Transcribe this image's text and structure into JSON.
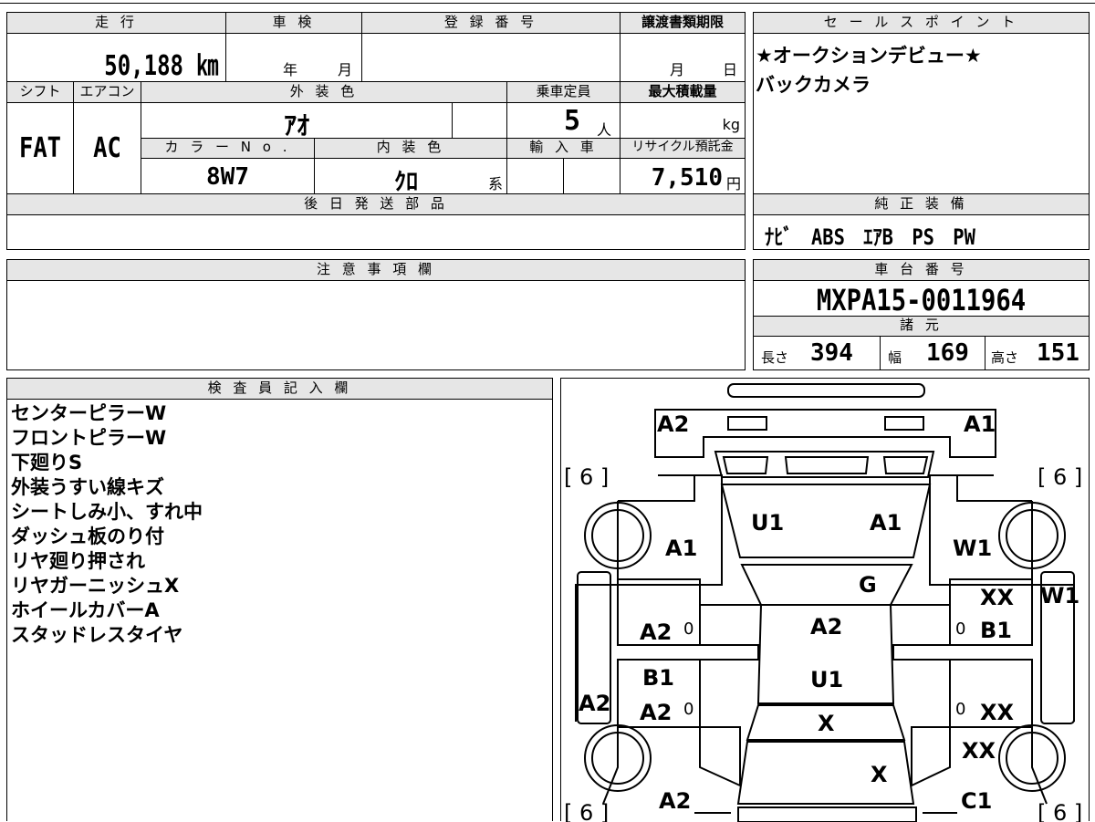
{
  "labels": {
    "mileage": "走 行",
    "inspection": "車 検",
    "registration_no": "登 録 番 号",
    "transfer_deadline": "譲渡書類期限",
    "sales_point": "セ ー ル ス ポ イ ン ト",
    "shift": "シフト",
    "aircon": "エアコン",
    "exterior_color": "外 装 色",
    "capacity": "乗車定員",
    "max_load": "最大積載量",
    "color_no": "カ ラ ー N o .",
    "interior_color": "内 装 色",
    "import": "輸 入 車",
    "recycle_fee": "リサイクル預託金",
    "parts_later": "後 日 発 送 部 品",
    "factory_equipment": "純 正 装 備",
    "caution": "注 意 事 項 欄",
    "chassis_no": "車 台 番 号",
    "specs": "諸 元",
    "inspector_notes": "検 査 員 記 入 欄",
    "year_unit": "年",
    "month_unit": "月",
    "day_unit": "日",
    "person_unit": "人",
    "kg_unit": "kg",
    "yen_unit": "円",
    "kei_unit": "系",
    "length_label": "長さ",
    "width_label": "幅",
    "height_label": "高さ"
  },
  "values": {
    "mileage": "50,188 ㎞",
    "shift": "FAT",
    "aircon": "AC",
    "exterior_color": "ｱｵ",
    "capacity": "5",
    "color_no": "8W7",
    "interior_color": "ｸﾛ",
    "recycle_fee": "7,510",
    "factory_equipment": "ﾅﾋﾞ　ABS　ｴｱB　PS　PW",
    "chassis_no": "MXPA15-0011964",
    "length": "394",
    "width": "169",
    "height": "151"
  },
  "sales_points": [
    "★オークションデビュー★",
    "バックカメラ"
  ],
  "inspector_notes": [
    "センターピラーW",
    "フロントピラーW",
    "下廻りS",
    "外装うすい線キズ",
    "シートしみ小、すれ中",
    "ダッシュ板のり付",
    "リヤ廻り押され",
    "リヤガーニッシュX",
    "ホイールカバーA",
    "スタッドレスタイヤ"
  ],
  "diagram": {
    "tire_left_top": "[ 6 ]",
    "tire_right_top": "[ 6 ]",
    "tire_left_bottom": "[ 6 ]",
    "tire_right_bottom": "[ 6 ]",
    "marks": {
      "front_bumper_left": "A2",
      "front_bumper_right": "A1",
      "hood_left": "U1",
      "hood_right": "A1",
      "fender_left": "A1",
      "fender_right": "W1",
      "windshield": "G",
      "pillar_right": "W1",
      "door_fr_top": "XX",
      "door_fl": "A2",
      "door_fr": "B1",
      "roof": "A2",
      "roof_lower": "U1",
      "door_rl_top": "B1",
      "door_rl": "A2",
      "door_rr": "XX",
      "sill_left": "A2",
      "rear_glass": "X",
      "rear_quarter_right": "XX",
      "trunk": "X",
      "rear_bumper_left": "A2",
      "rear_bumper_right": "C1",
      "zero_1": "0",
      "zero_2": "0",
      "zero_3": "0",
      "zero_4": "0"
    }
  }
}
